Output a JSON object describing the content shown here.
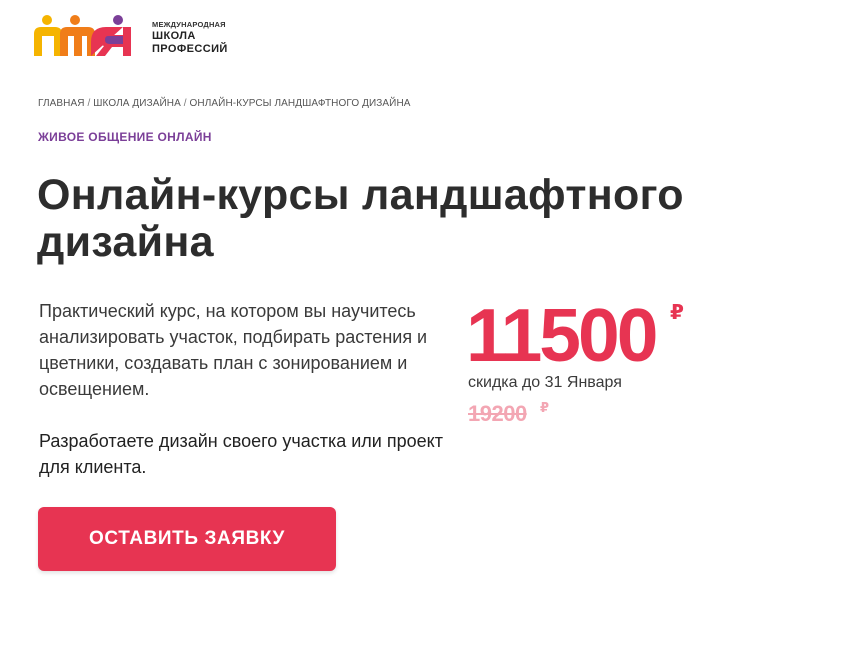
{
  "logo": {
    "line1": "МЕЖДУНАРОДНАЯ",
    "line2": "ШКОЛА",
    "line3": "ПРОФЕССИЙ",
    "colors": {
      "yellow": "#f5b400",
      "orange": "#f07d19",
      "red": "#e73452",
      "purple": "#7b3f98"
    }
  },
  "breadcrumb": {
    "items": [
      "ГЛАВНАЯ",
      "ШКОЛА ДИЗАЙНА",
      "ОНЛАЙН-КУРСЫ ЛАНДШАФТНОГО ДИЗАЙНА"
    ],
    "separator": "/"
  },
  "tagline": "ЖИВОЕ ОБЩЕНИЕ ОНЛАЙН",
  "title": "Онлайн-курсы ландшафтного дизайна",
  "description": "Практический курс, на котором вы научитесь анализировать участок, подбирать растения и цветники, создавать план с зонированием и освещением.",
  "description_bold": "Разработаете дизайн своего участка или проект для клиента.",
  "price": {
    "current": "11500",
    "currency": "₽",
    "discount_note": "скидка до 31 Января",
    "old": "19200",
    "old_currency": "₽"
  },
  "cta": {
    "label": "ОСТАВИТЬ ЗАЯВКУ"
  },
  "accent_color": "#e73452",
  "tagline_color": "#7b3f98"
}
